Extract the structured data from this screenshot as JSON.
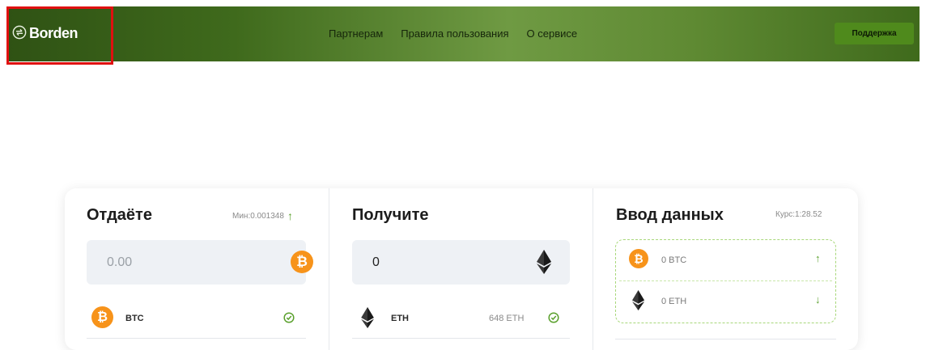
{
  "header": {
    "logo_text": "Borden",
    "nav": [
      "Партнерам",
      "Правила пользования",
      "О сервисе"
    ],
    "support_label": "Поддержка",
    "colors": {
      "header_dark": "#2f5214",
      "header_light": "#6f9a43",
      "button": "#4f8a1c",
      "highlight": "#e01010"
    }
  },
  "give": {
    "title": "Отдаёте",
    "min_label": "Мин:0.001348",
    "amount_placeholder": "0.00",
    "currency": "BTC",
    "icon": "bitcoin-icon"
  },
  "receive": {
    "title": "Получите",
    "amount": "0",
    "currency": "ETH",
    "reserve": "648 ETH",
    "icon": "ethereum-icon"
  },
  "input": {
    "title": "Ввод данных",
    "rate": "Курс:1:28.52",
    "give_line": "0 BTC",
    "receive_line": "0 ETH"
  }
}
